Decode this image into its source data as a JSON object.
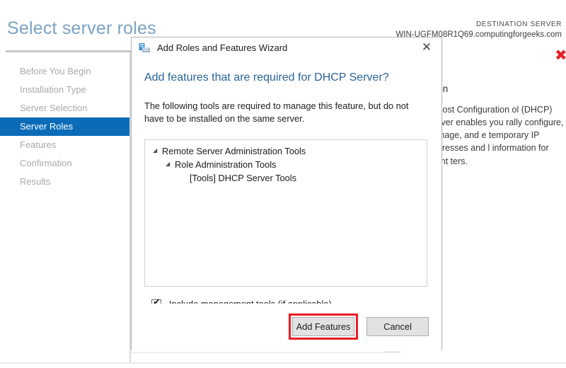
{
  "background": {
    "page_title": "Select server roles",
    "destination_server": {
      "label": "DESTINATION SERVER",
      "name": "WIN-UGFM08R1Q69.computingforgeeks.com"
    },
    "red_mark": "✖",
    "nav": {
      "items": [
        {
          "label": "Before You Begin",
          "selected": false
        },
        {
          "label": "Installation Type",
          "selected": false
        },
        {
          "label": "Server Selection",
          "selected": false
        },
        {
          "label": "Server Roles",
          "selected": true
        },
        {
          "label": "Features",
          "selected": false
        },
        {
          "label": "Confirmation",
          "selected": false
        },
        {
          "label": "Results",
          "selected": false
        }
      ]
    },
    "description_panel": {
      "heading": "ption",
      "body": "ic Host Configuration ol (DHCP) Server enables you rally configure, manage, and e temporary IP addresses and l information for client ters."
    }
  },
  "dialog": {
    "title": "Add Roles and Features Wizard",
    "icon": "wizard-icon",
    "close_glyph": "✕",
    "heading": "Add features that are required for DHCP Server?",
    "message": "The following tools are required to manage this feature, but do not have to be installed on the same server.",
    "tree": {
      "expand_glyph": "◢",
      "nodes": [
        {
          "level": 0,
          "label": "Remote Server Administration Tools",
          "expandable": true
        },
        {
          "level": 1,
          "label": "Role Administration Tools",
          "expandable": true
        },
        {
          "level": 2,
          "label": "[Tools] DHCP Server Tools",
          "expandable": false
        }
      ]
    },
    "checkbox": {
      "label": "Include management tools (if applicable)",
      "checked": true,
      "tick_glyph": "✔"
    },
    "buttons": {
      "primary": "Add Features",
      "secondary": "Cancel"
    }
  },
  "colors": {
    "accent_blue": "#0a6cb8",
    "title_blue": "#7aa3c4",
    "heading_blue": "#2a6496",
    "highlight_red": "#ee1c23",
    "red_x": "#e8222a",
    "button_face": "#e2e2e2"
  }
}
